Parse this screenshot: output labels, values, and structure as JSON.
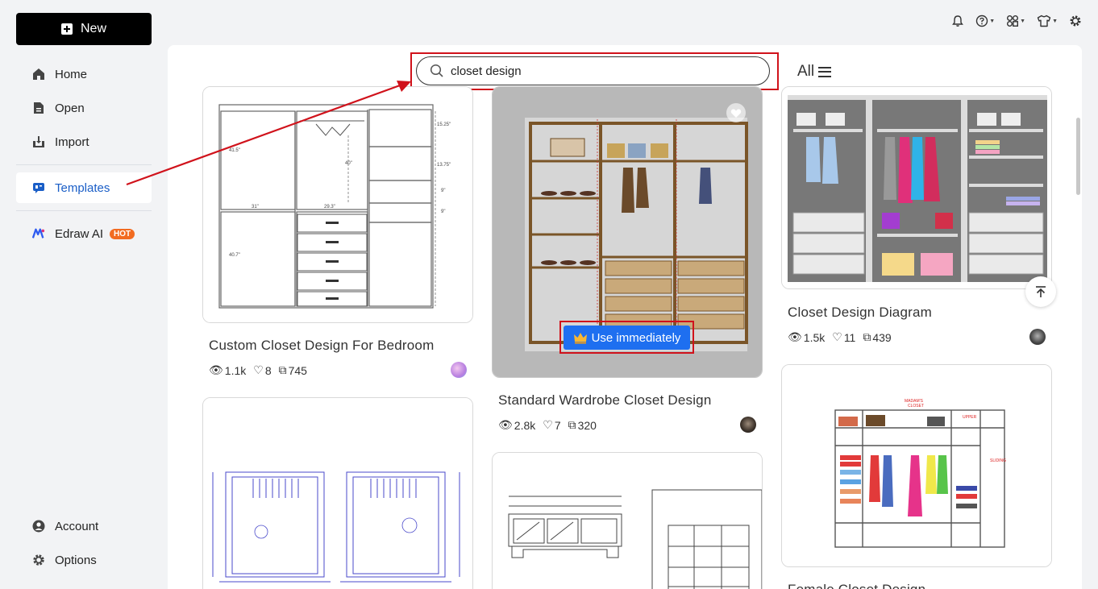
{
  "sidebar": {
    "new_label": "New",
    "items": [
      {
        "label": "Home",
        "icon": "home-icon"
      },
      {
        "label": "Open",
        "icon": "file-icon"
      },
      {
        "label": "Import",
        "icon": "import-icon"
      },
      {
        "label": "Templates",
        "icon": "templates-icon"
      },
      {
        "label": "Edraw AI",
        "icon": "edraw-ai-icon"
      }
    ],
    "hot_badge": "HOT",
    "bottom_items": [
      {
        "label": "Account",
        "icon": "account-icon"
      },
      {
        "label": "Options",
        "icon": "gear-icon"
      }
    ]
  },
  "header": {
    "icons": [
      "bell-icon",
      "help-icon",
      "apps-icon",
      "shirt-icon",
      "settings-icon"
    ]
  },
  "search": {
    "value": "closet design",
    "filter_label": "All"
  },
  "cards": [
    {
      "title": "Custom Closet Design For Bedroom",
      "views": "1.1k",
      "likes": "8",
      "copies": "745"
    },
    {
      "title": "Standard Wardrobe Closet Design",
      "views": "2.8k",
      "likes": "7",
      "copies": "320"
    },
    {
      "title": "Closet Design Diagram",
      "views": "1.5k",
      "likes": "11",
      "copies": "439"
    },
    {
      "title": "Female Closet Design"
    }
  ],
  "use_button": "Use immediately",
  "colors": {
    "accent": "#1a5ec7",
    "use_button": "#1e6ff0",
    "highlight_red": "#d0121b",
    "hot": "#f26b21"
  }
}
